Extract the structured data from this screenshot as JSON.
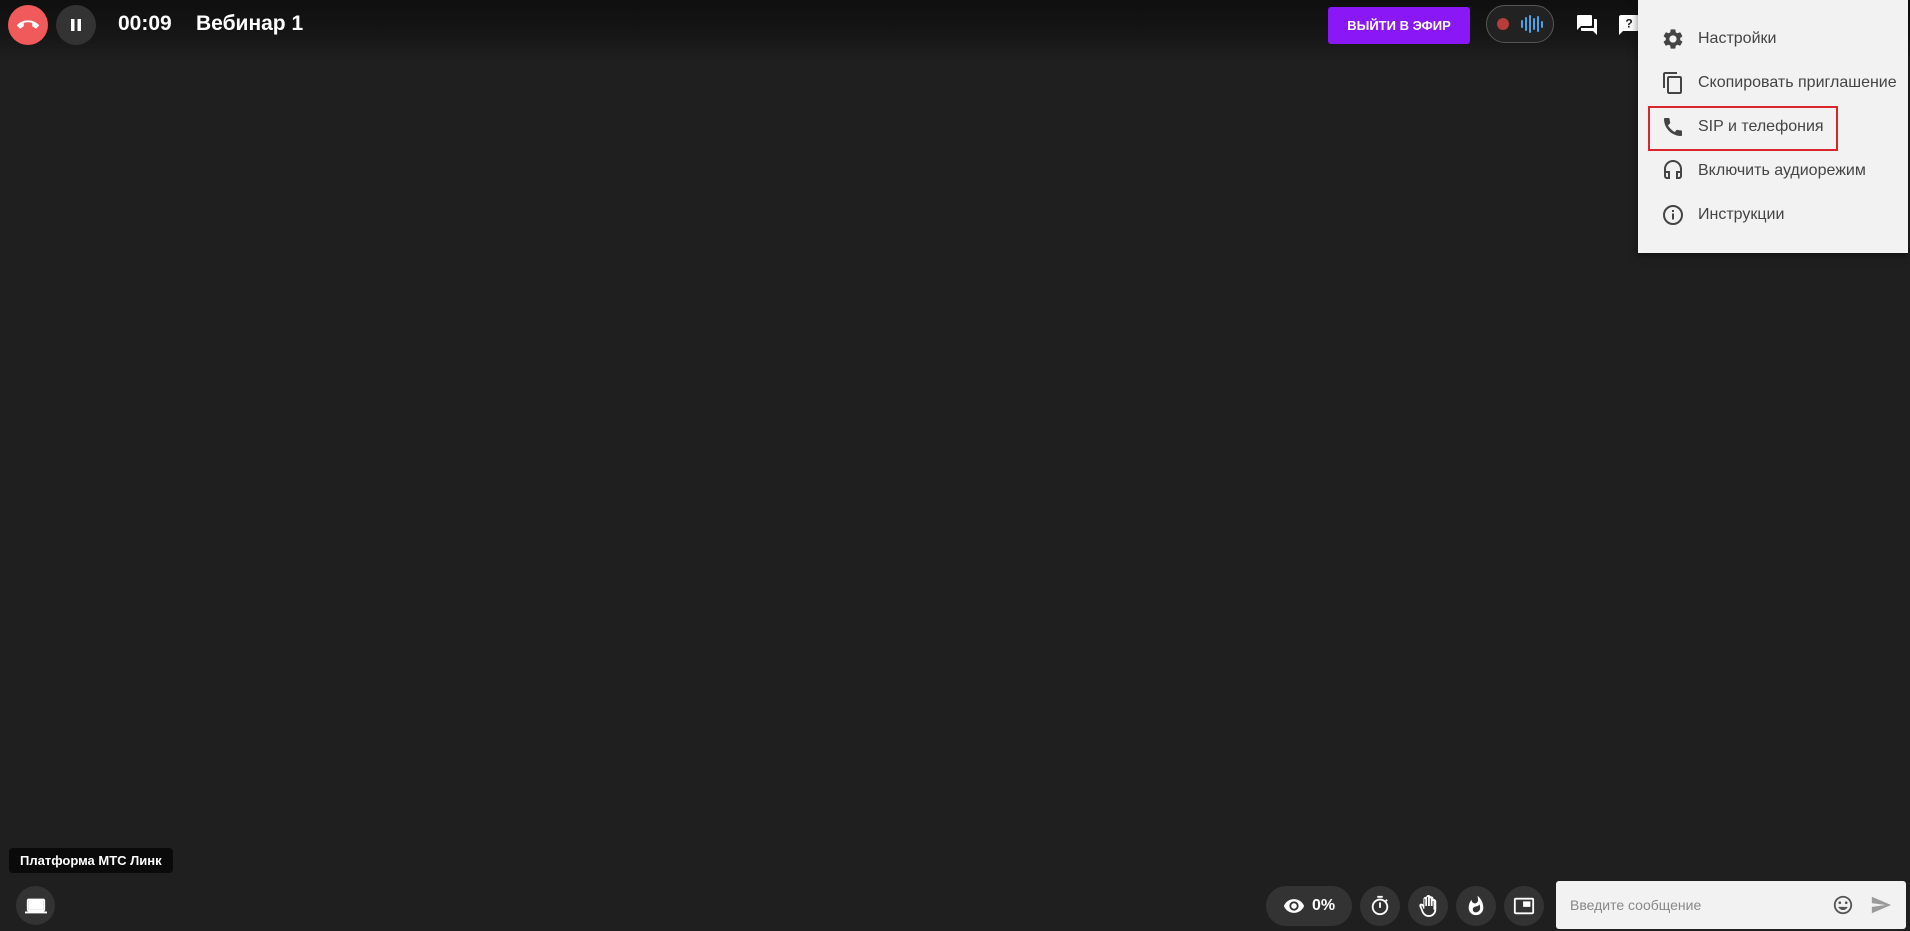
{
  "topbar": {
    "timer": "00:09",
    "title": "Вебинар 1",
    "onair_label": "ВЫЙТИ В ЭФИР"
  },
  "menu": {
    "items": [
      {
        "icon": "gear-icon",
        "label": "Настройки"
      },
      {
        "icon": "copy-icon",
        "label": "Скопировать приглашение"
      },
      {
        "icon": "phone-icon",
        "label": "SIP и телефония"
      },
      {
        "icon": "headset-icon",
        "label": "Включить аудиорежим"
      },
      {
        "icon": "info-icon",
        "label": "Инструкции"
      }
    ],
    "highlighted_item": "SIP и телефония"
  },
  "footer": {
    "brand": "Платформа МТС Линк",
    "viewers_percent": "0%",
    "chat_placeholder": "Введите сообщение"
  },
  "colors": {
    "background": "#1f1f1f",
    "hangup": "#f05a5a",
    "onair": "#8a17f5",
    "record_dot": "#b73c3c",
    "wave": "#4aa3e8",
    "highlight": "#d9262d",
    "menu_bg": "#f2f2f2"
  }
}
